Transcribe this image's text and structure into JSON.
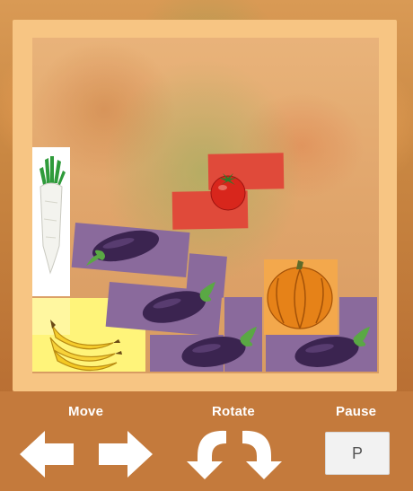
{
  "game": {
    "board": {
      "pieces": [
        {
          "name": "daikon",
          "color": "#ffffff"
        },
        {
          "name": "eggplant",
          "color": "#8a6a9c"
        },
        {
          "name": "tomato",
          "color": "#e04a3a"
        },
        {
          "name": "pumpkin",
          "color": "#f3a84c"
        },
        {
          "name": "banana",
          "color": "#fff07a"
        }
      ]
    }
  },
  "controls": {
    "move_label": "Move",
    "rotate_label": "Rotate",
    "pause_label": "Pause",
    "pause_key": "P",
    "icons": [
      "arrow-left-icon",
      "arrow-right-icon",
      "rotate-left-icon",
      "rotate-right-icon"
    ]
  }
}
